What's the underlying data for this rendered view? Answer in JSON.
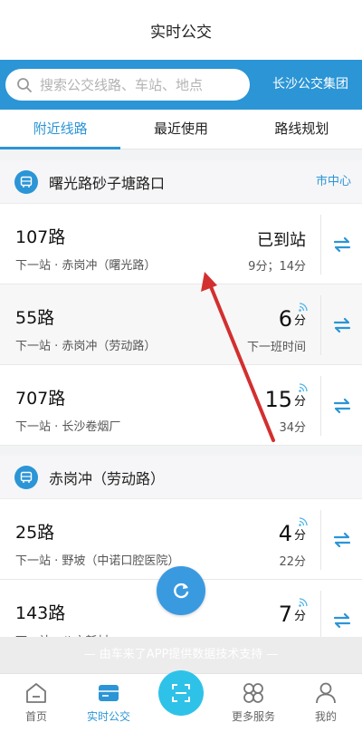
{
  "header": {
    "title": "实时公交"
  },
  "search": {
    "placeholder": "搜索公交线路、车站、地点",
    "group_name": "长沙公交集团"
  },
  "tabs": [
    {
      "label": "附近线路",
      "active": true
    },
    {
      "label": "最近使用",
      "active": false
    },
    {
      "label": "路线规划",
      "active": false
    }
  ],
  "stops": [
    {
      "name": "曙光路砂子塘路口",
      "area": "市中心",
      "routes": [
        {
          "route": "107路",
          "next": "下一站 · 赤岗冲（曙光路）",
          "eta_text": "已到站",
          "eta_sub": "9分；14分"
        },
        {
          "route": "55路",
          "next": "下一站 · 赤岗冲（劳动路）",
          "eta_value": "6",
          "eta_unit": "分",
          "eta_sub": "下一班时间"
        },
        {
          "route": "707路",
          "next": "下一站 · 长沙卷烟厂",
          "eta_value": "15",
          "eta_unit": "分",
          "eta_sub": "34分"
        }
      ]
    },
    {
      "name": "赤岗冲（劳动路）",
      "routes": [
        {
          "route": "25路",
          "next": "下一站 · 野坡（中诺口腔医院）",
          "eta_value": "4",
          "eta_unit": "分",
          "eta_sub": "22分"
        },
        {
          "route": "143路",
          "next": "下一站 · 八方新村",
          "eta_value": "7",
          "eta_unit": "分",
          "eta_sub": ""
        }
      ]
    }
  ],
  "footer_note": "— 由车来了APP提供数据技术支持 —",
  "nav": [
    {
      "label": "首页",
      "icon": "home-icon"
    },
    {
      "label": "实时公交",
      "icon": "bus-card-icon",
      "active": true
    },
    {
      "label": "",
      "icon": "scan-icon"
    },
    {
      "label": "更多服务",
      "icon": "grid-icon"
    },
    {
      "label": "我的",
      "icon": "user-icon"
    }
  ],
  "colors": {
    "accent": "#2b95d6",
    "arrow_annotation": "#d32f2f"
  }
}
